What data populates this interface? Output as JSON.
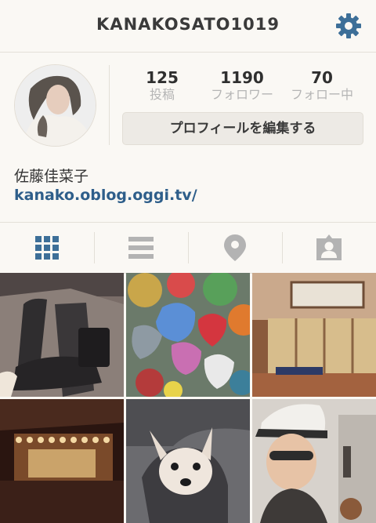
{
  "header": {
    "username": "KANAKOSATO1019",
    "settings_icon": "gear-icon"
  },
  "profile": {
    "stats": [
      {
        "value": "125",
        "label": "投稿"
      },
      {
        "value": "1190",
        "label": "フォロワー"
      },
      {
        "value": "70",
        "label": "フォロー中"
      }
    ],
    "edit_label": "プロフィールを編集する",
    "display_name": "佐藤佳菜子",
    "website": "kanako.oblog.oggi.tv/"
  },
  "tabs": [
    {
      "icon": "grid-icon",
      "active": true
    },
    {
      "icon": "list-icon",
      "active": false
    },
    {
      "icon": "location-pin-icon",
      "active": false
    },
    {
      "icon": "tagged-photos-icon",
      "active": false
    }
  ],
  "colors": {
    "accent": "#3d6f98",
    "link": "#2e5e8a",
    "inactive_icon": "#b3b3b3"
  }
}
